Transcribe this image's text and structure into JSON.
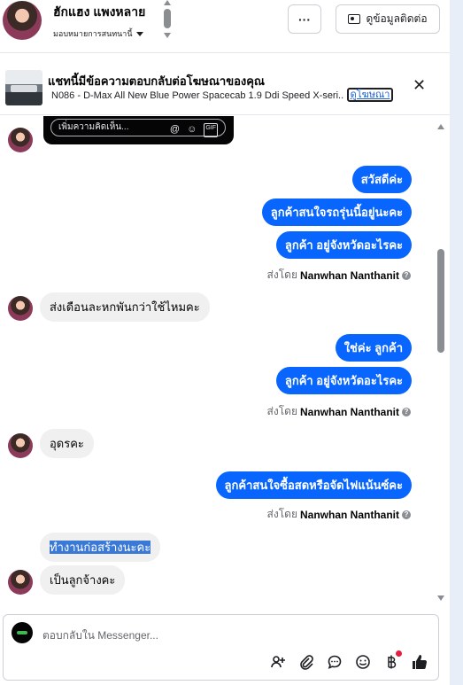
{
  "header": {
    "name": "ฮักแฮง แพงหลาย",
    "assign": "มอบหมายการสนทนานี้",
    "more_label": "···",
    "contact_label": "ดูข้อมูลติดต่อ"
  },
  "ad": {
    "title": "แชทนี้มีข้อความตอบกลับต่อโฆษณาของคุณ",
    "subtitle": "N086 - D-Max All New Blue Power Spacecab 1.9 Ddi Speed X-seri...",
    "link": "ดูโฆษณา",
    "close": "✕"
  },
  "comment_box": {
    "placeholder": "เพิ่มความคิดเห็น...",
    "icons": [
      "at-icon",
      "emoji-icon",
      "gif-icon"
    ],
    "at": "@",
    "emoji": "☺",
    "gif": "GIF"
  },
  "messages": [
    {
      "dir": "out",
      "text": "สวัสดีค่ะ"
    },
    {
      "dir": "out",
      "text": "ลูกค้าสนใจรถรุ่นนี้อยู่นะคะ"
    },
    {
      "dir": "out",
      "text": "ลูกค้า อยู่จังหวัดอะไรคะ"
    },
    {
      "dir": "in",
      "text": "ส่งเดือนละหกพันกว่าใช้ไหมคะ"
    },
    {
      "dir": "out",
      "text": "ใช่ค่ะ  ลูกค้า"
    },
    {
      "dir": "out",
      "text": "ลูกค้า อยู่จังหวัดอะไรคะ"
    },
    {
      "dir": "in",
      "text": "อุดรคะ"
    },
    {
      "dir": "out",
      "text": "ลูกค้าสนใจซื้อสดหรือจัดไฟแน้นซ์คะ"
    },
    {
      "dir": "in",
      "text": "ทำงานก่อสร้างนะคะ",
      "highlighted": true
    },
    {
      "dir": "in",
      "text": "เป็นลูกจ้างคะ"
    }
  ],
  "sent_by": {
    "prefix": "ส่งโดย",
    "name": "Nanwhan Nanthanit",
    "info": "?"
  },
  "composer": {
    "placeholder": "ตอบกลับใน Messenger...",
    "tools": [
      "add-person-icon",
      "attachment-icon",
      "chat-bubble-icon",
      "emoji-icon",
      "baht-icon",
      "like-icon"
    ]
  },
  "colors": {
    "outgoing_bubble": "#0866ff",
    "incoming_bubble": "#f0f0f0",
    "highlight": "#3a79d6"
  }
}
